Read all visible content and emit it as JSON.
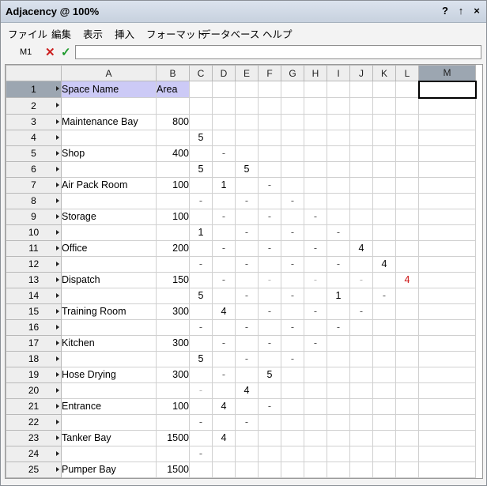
{
  "window": {
    "title": "Adjacency @ 100%",
    "help_label": "?",
    "pin_label": "↑",
    "close_label": "×"
  },
  "menu": {
    "items": [
      "ファイル",
      "編集",
      "表示",
      "挿入",
      "フォーマット",
      "データベース",
      "ヘルプ"
    ]
  },
  "formula": {
    "cell_ref": "M1",
    "value": ""
  },
  "columns": [
    "A",
    "B",
    "C",
    "D",
    "E",
    "F",
    "G",
    "H",
    "I",
    "J",
    "K",
    "L",
    "M"
  ],
  "selected_column": "M",
  "rows": [
    {
      "n": "1",
      "a": "Space Name",
      "b": "Area",
      "cells": {}
    },
    {
      "n": "2",
      "a": "",
      "b": "",
      "cells": {}
    },
    {
      "n": "3",
      "a": "Maintenance Bay",
      "b": "800",
      "cells": {}
    },
    {
      "n": "4",
      "a": "",
      "b": "",
      "cells": {
        "C": "5"
      }
    },
    {
      "n": "5",
      "a": "Shop",
      "b": "400",
      "cells": {
        "D": "-"
      }
    },
    {
      "n": "6",
      "a": "",
      "b": "",
      "cells": {
        "C": "5",
        "E": "5"
      }
    },
    {
      "n": "7",
      "a": "Air Pack Room",
      "b": "100",
      "cells": {
        "D": "1",
        "F": "-"
      }
    },
    {
      "n": "8",
      "a": "",
      "b": "",
      "cells": {
        "C": "-",
        "E": "-",
        "G": "-"
      }
    },
    {
      "n": "9",
      "a": "Storage",
      "b": "100",
      "cells": {
        "D": "-",
        "F": "-",
        "H": "-"
      }
    },
    {
      "n": "10",
      "a": "",
      "b": "",
      "cells": {
        "C": "1",
        "E": "-",
        "G": "-",
        "I": "-"
      }
    },
    {
      "n": "11",
      "a": "Office",
      "b": "200",
      "cells": {
        "D": "-",
        "F": "-",
        "H": "-",
        "J": "4"
      }
    },
    {
      "n": "12",
      "a": "",
      "b": "",
      "cells": {
        "C": "-",
        "E": "-",
        "G": "-",
        "I": "-",
        "K": "4"
      }
    },
    {
      "n": "13",
      "a": "Dispatch",
      "b": "150",
      "cells": {
        "D": "-",
        "F": "-",
        "H": "-",
        "J": "-",
        "L": "4"
      }
    },
    {
      "n": "14",
      "a": "",
      "b": "",
      "cells": {
        "C": "5",
        "E": "-",
        "G": "-",
        "I": "1",
        "K": "-"
      }
    },
    {
      "n": "15",
      "a": "Training Room",
      "b": "300",
      "cells": {
        "D": "4",
        "F": "-",
        "H": "-",
        "J": "-"
      }
    },
    {
      "n": "16",
      "a": "",
      "b": "",
      "cells": {
        "C": "-",
        "E": "-",
        "G": "-",
        "I": "-"
      }
    },
    {
      "n": "17",
      "a": "Kitchen",
      "b": "300",
      "cells": {
        "D": "-",
        "F": "-",
        "H": "-"
      }
    },
    {
      "n": "18",
      "a": "",
      "b": "",
      "cells": {
        "C": "5",
        "E": "-",
        "G": "-"
      }
    },
    {
      "n": "19",
      "a": "Hose Drying",
      "b": "300",
      "cells": {
        "D": "-",
        "F": "5"
      }
    },
    {
      "n": "20",
      "a": "",
      "b": "",
      "cells": {
        "C": "-",
        "E": "4"
      }
    },
    {
      "n": "21",
      "a": "Entrance",
      "b": "100",
      "cells": {
        "D": "4",
        "F": "-"
      }
    },
    {
      "n": "22",
      "a": "",
      "b": "",
      "cells": {
        "C": "-",
        "E": "-"
      }
    },
    {
      "n": "23",
      "a": "Tanker Bay",
      "b": "1500",
      "cells": {
        "D": "4"
      }
    },
    {
      "n": "24",
      "a": "",
      "b": "",
      "cells": {
        "C": "-"
      }
    },
    {
      "n": "25",
      "a": "Pumper Bay",
      "b": "1500",
      "cells": {}
    }
  ],
  "colors": {
    "header_fill": "#cccaf6",
    "selected_header": "#9ca6b1",
    "red_digit": "#cc1111"
  }
}
